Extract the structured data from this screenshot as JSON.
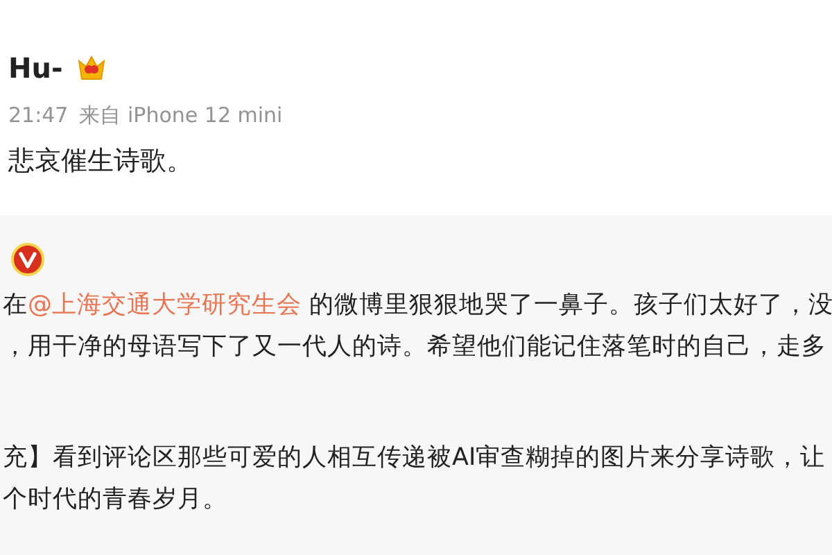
{
  "post": {
    "author": "Hu-",
    "meta_time": "21:47",
    "meta_source": "来自 iPhone 12 mini",
    "text": "悲哀催生诗歌。"
  },
  "repost": {
    "verified": true,
    "lines": [
      {
        "kind": "mention",
        "before": "在",
        "mention": "@上海交通大学研究生会",
        "after": " 的微博里狠狠地哭了一鼻子。孩子们太好了，没"
      },
      {
        "kind": "plain",
        "text": "，用干净的母语写下了又一代人的诗。希望他们能记住落笔时的自己，走多"
      },
      {
        "kind": "gap"
      },
      {
        "kind": "plain",
        "text": "充】看到评论区那些可爱的人相互传递被AI审查糊掉的图片来分享诗歌，让"
      },
      {
        "kind": "plain",
        "text": "个时代的青春岁月。"
      }
    ]
  }
}
